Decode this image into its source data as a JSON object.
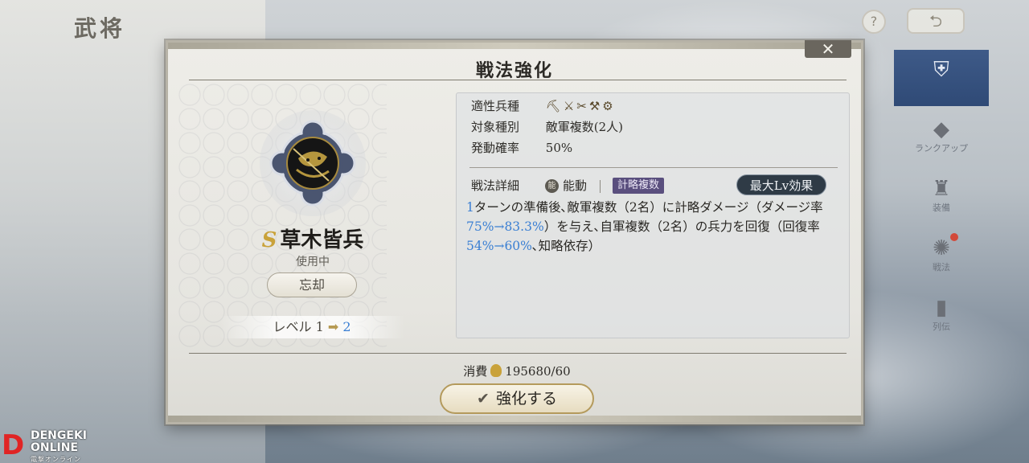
{
  "background": {
    "screen_title": "武将",
    "help_label": "?",
    "back_label": "⮌",
    "nav_items": [
      {
        "label": "",
        "icon": "armor-icon"
      },
      {
        "label": "ランクアップ",
        "icon": "rank-icon"
      },
      {
        "label": "装備",
        "icon": "equip-icon"
      },
      {
        "label": "戦法",
        "icon": "tactic-icon"
      },
      {
        "label": "列伝",
        "icon": "book-icon"
      }
    ]
  },
  "modal": {
    "title": "戦法強化",
    "close_label": "✕",
    "skill": {
      "rank": "S",
      "name": "草木皆兵",
      "status": "使用中",
      "forget_label": "忘却",
      "level_label": "レベル",
      "level_current": "1",
      "level_arrow": "➡",
      "level_next": "2"
    },
    "info": {
      "unit_label": "適性兵種",
      "unit_icons": "⛏⚔✂⚒⚙",
      "target_label": "対象種別",
      "target_value": "敵軍複数(2人)",
      "rate_label": "発動確率",
      "rate_value": "50%",
      "detail_label": "戦法詳細",
      "active_icon": "能",
      "active_label": "能動",
      "type_badge": "計略複数",
      "max_lv_label": "最大Lv効果",
      "desc_parts": {
        "p1": "1",
        "p2": "ターンの準備後､敵軍複数（2名）に計略ダメージ（ダメージ率",
        "p3": "75%→83.3%",
        "p4": "）を与え､自軍複数（2名）の兵力を回復（回復率",
        "p5": "54%→60%",
        "p6": "､知略依存）"
      }
    },
    "cost_label": "消費",
    "cost_value": "195680/60",
    "enhance_check": "✔",
    "enhance_label": "強化する"
  },
  "logo": {
    "line1": "DENGEKI",
    "line2": "ONLINE",
    "sub": "電撃オンライン",
    "mark": "D"
  },
  "colors": {
    "highlight": "#3a7fd3",
    "rank_gold": "#c9a23a",
    "badge_purple": "#5a4f7e",
    "nav_active": "#2f4a76"
  }
}
